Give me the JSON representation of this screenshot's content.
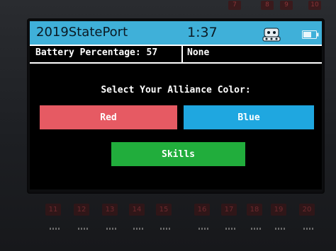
{
  "device": {
    "top_ports": [
      "7",
      "8",
      "9",
      "10"
    ],
    "bottom_ports": [
      "11",
      "12",
      "13",
      "14",
      "15",
      "16",
      "17",
      "18",
      "19",
      "20"
    ]
  },
  "title_bar": {
    "app_name": "2019StatePort",
    "time": "1:37",
    "robot_icon": "robot-icon",
    "battery_icon": "battery-icon",
    "color": "#3fb0d9"
  },
  "status": {
    "battery_label": "Battery Percentage: 57",
    "mode": "None"
  },
  "main": {
    "prompt": "Select Your Alliance Color:",
    "buttons": {
      "red": {
        "label": "Red",
        "color": "#e65a63"
      },
      "blue": {
        "label": "Blue",
        "color": "#1fa7e0"
      },
      "skills": {
        "label": "Skills",
        "color": "#21ad3c"
      }
    }
  }
}
